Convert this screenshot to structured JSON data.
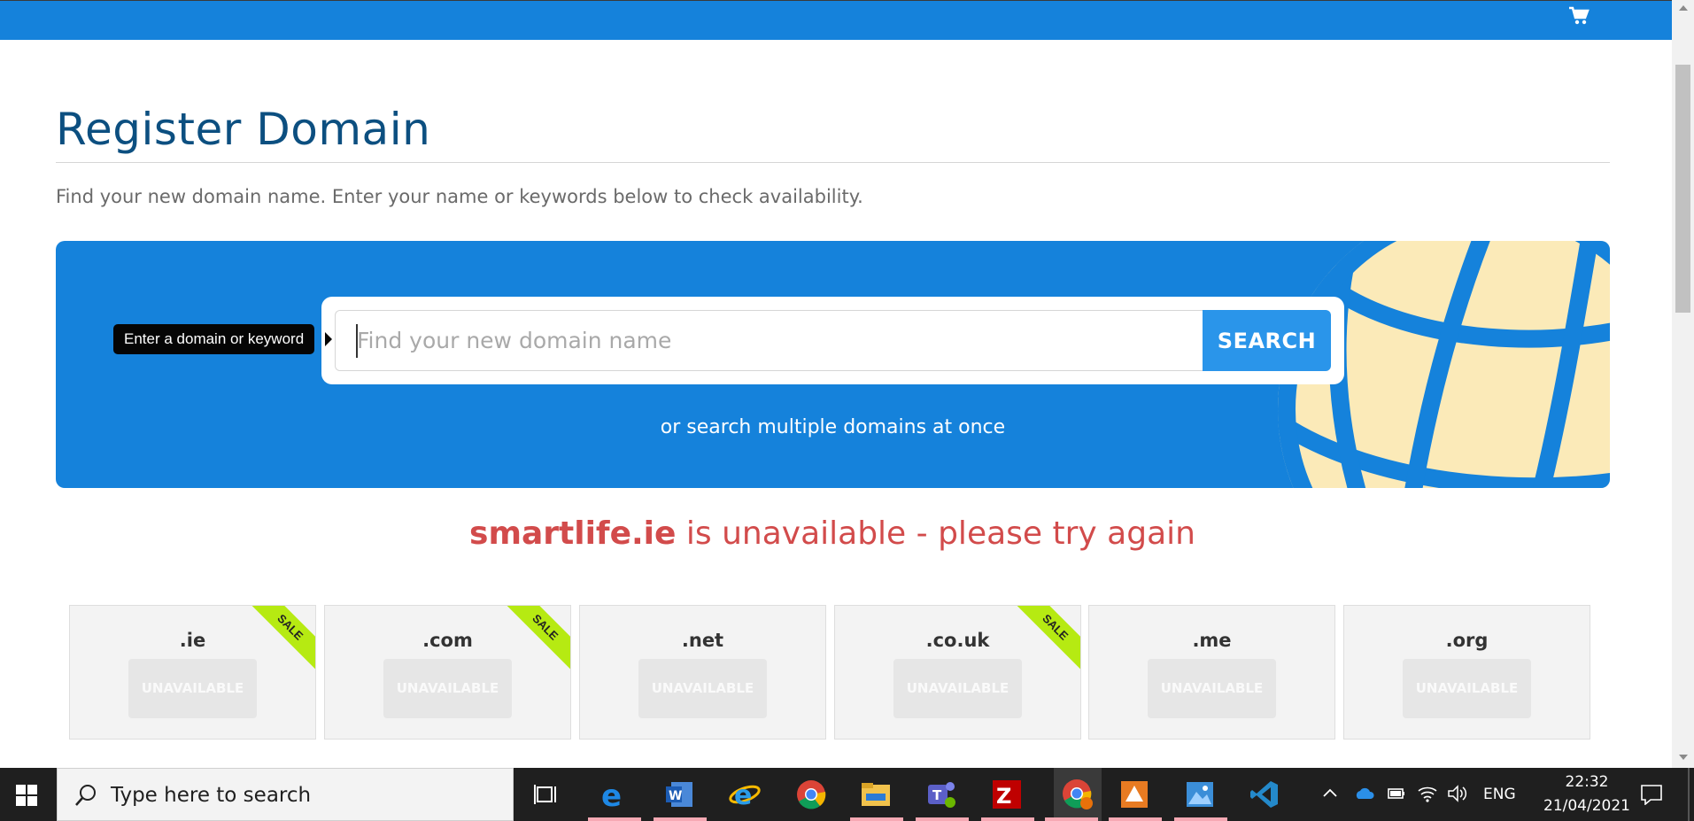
{
  "header": {
    "cart_icon": "shopping-cart-icon",
    "bar_color": "#1582db"
  },
  "page": {
    "title": "Register Domain",
    "intro": "Find your new domain name. Enter your name or keywords below to check availability."
  },
  "search": {
    "placeholder": "Find your new domain name",
    "button_label": "SEARCH",
    "tooltip": "Enter a domain or keyword",
    "multi_link": "or search multiple domains at once",
    "globe_icon": "globe-icon"
  },
  "result": {
    "domain": "smartlife.ie",
    "message": " is unavailable - please try again",
    "color": "#d24b4b"
  },
  "tlds": [
    {
      "name": ".ie",
      "status": "UNAVAILABLE",
      "sale": "SALE"
    },
    {
      "name": ".com",
      "status": "UNAVAILABLE",
      "sale": "SALE"
    },
    {
      "name": ".net",
      "status": "UNAVAILABLE",
      "sale": ""
    },
    {
      "name": ".co.uk",
      "status": "UNAVAILABLE",
      "sale": "SALE"
    },
    {
      "name": ".me",
      "status": "UNAVAILABLE",
      "sale": ""
    },
    {
      "name": ".org",
      "status": "UNAVAILABLE",
      "sale": ""
    }
  ],
  "taskbar": {
    "search_placeholder": "Type here to search",
    "apps": [
      "task-view-icon",
      "edge-icon",
      "word-icon",
      "internet-explorer-icon",
      "chrome-icon",
      "file-explorer-icon",
      "teams-icon",
      "filezilla-icon",
      "chrome-profile-icon",
      "app-icon",
      "photos-icon",
      "vscode-icon"
    ],
    "language": "ENG",
    "time": "22:32",
    "date": "21/04/2021"
  }
}
